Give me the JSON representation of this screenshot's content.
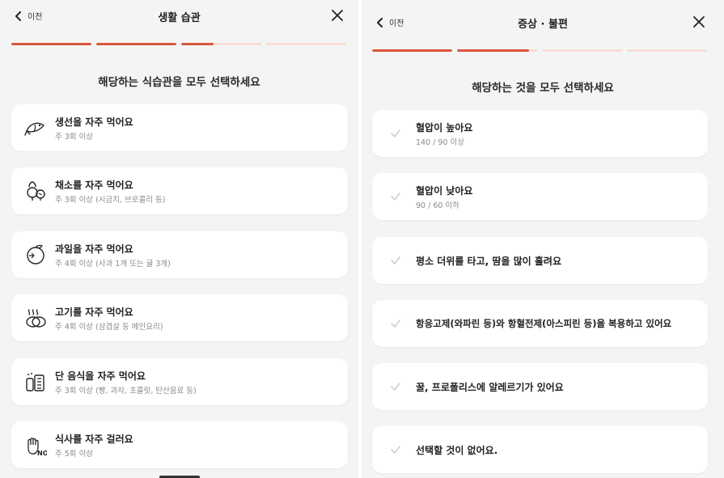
{
  "left": {
    "header": {
      "back_label": "이전",
      "title": "생활 습관"
    },
    "progress": [
      1,
      1,
      0.4,
      0
    ],
    "question": "해당하는 식습관을 모두 선택하세요",
    "options": [
      {
        "icon": "fish-icon",
        "label": "생선을 자주 먹어요",
        "sub": "주 3회 이상"
      },
      {
        "icon": "vegetable-icon",
        "label": "채소를 자주 먹어요",
        "sub": "주 3회 이상 (시금치, 브로콜리 등)"
      },
      {
        "icon": "fruit-icon",
        "label": "과일을 자주 먹어요",
        "sub": "주 4회 이상 (사과 1개 또는 귤 3개)"
      },
      {
        "icon": "meat-icon",
        "label": "고기를 자주 먹어요",
        "sub": "주 4회 이상 (삼겹살 등 메인요리)"
      },
      {
        "icon": "sweets-icon",
        "label": "단 음식을 자주 먹어요",
        "sub": "주 3회 이상 (빵, 과자, 초콜릿, 탄산음료 등)"
      },
      {
        "icon": "skip-meal-icon",
        "label": "식사를 자주 걸러요",
        "sub": "주 5회 이상"
      }
    ]
  },
  "right": {
    "header": {
      "back_label": "이전",
      "title": "증상 · 불편"
    },
    "progress": [
      1,
      0.9,
      0,
      0
    ],
    "question": "해당하는 것을 모두 선택하세요",
    "options": [
      {
        "label": "혈압이 높아요",
        "sub": "140 / 90 이상"
      },
      {
        "label": "혈압이 낮아요",
        "sub": "90 / 60 이하"
      },
      {
        "label": "평소 더위를 타고, 땀을 많이 흘려요",
        "sub": ""
      },
      {
        "label": "항응고제(와파린 등)와 항혈전제(아스피린 등)을 복용하고 있어요",
        "sub": ""
      },
      {
        "label": "꿀, 프로폴리스에 알레르기가 있어요",
        "sub": ""
      },
      {
        "label": "선택할 것이 없어요.",
        "sub": ""
      }
    ]
  },
  "colors": {
    "accent": "#d9573a",
    "track": "#f6ddd6",
    "background": "#f4f4f4",
    "card": "#ffffff"
  }
}
